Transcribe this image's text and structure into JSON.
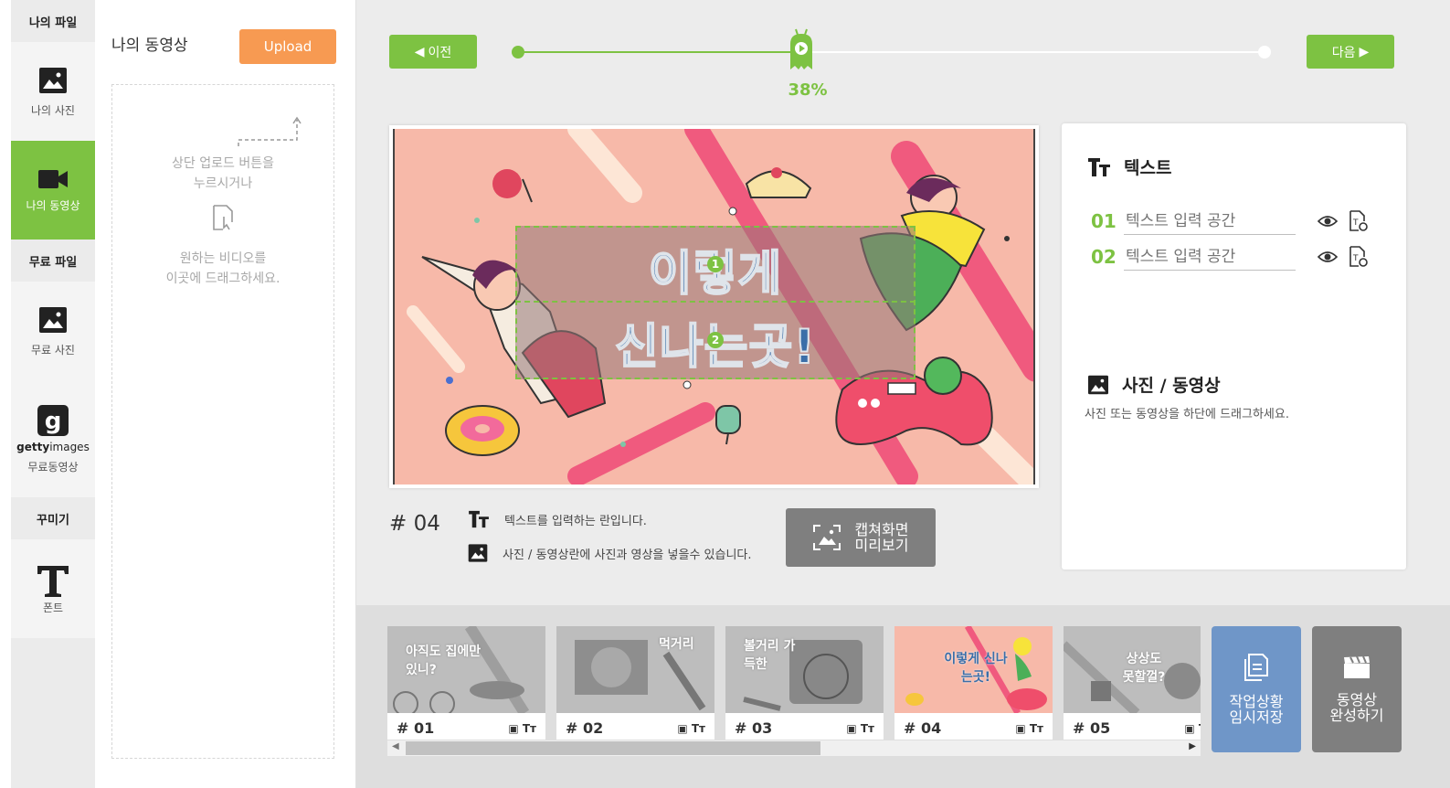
{
  "sidebar": {
    "my_files_header": "나의 파일",
    "my_photo": "나의 사진",
    "my_video": "나의 동영상",
    "free_files_header": "무료 파일",
    "free_photo": "무료 사진",
    "getty_brand_bold": "getty",
    "getty_brand": "images",
    "free_video": "무료동영상",
    "decorate_header": "꾸미기",
    "font": "폰트"
  },
  "files_panel": {
    "title": "나의 동영상",
    "upload_label": "Upload",
    "hint_line1": "상단 업로드 버튼을",
    "hint_line2": "누르시거나",
    "hint_line3": "원하는 비디오를",
    "hint_line4": "이곳에 드래그하세요."
  },
  "progress": {
    "prev_label": "이전",
    "next_label": "다음",
    "percent_text": "38%",
    "fraction": 0.38
  },
  "canvas": {
    "line1": "이렇게",
    "line2": "신나는곳!",
    "marker1": "1",
    "marker2": "2"
  },
  "scene": {
    "number": "# 04",
    "text_hint": "텍스트를 입력하는 란입니다.",
    "media_hint": "사진 / 동영상란에 사진과 영상을 넣을수 있습니다.",
    "capture_line1": "캡쳐화면",
    "capture_line2": "미리보기"
  },
  "props": {
    "text_title": "텍스트",
    "text_rows": [
      {
        "num": "01",
        "placeholder": "텍스트 입력 공간"
      },
      {
        "num": "02",
        "placeholder": "텍스트 입력 공간"
      }
    ],
    "media_title": "사진 / 동영상",
    "media_hint": "사진 또는 동영상을 하단에 드래그하세요."
  },
  "thumbnails": [
    {
      "label": "# 01",
      "text": "아직도 집에만 있니?"
    },
    {
      "label": "# 02",
      "text": "먹거리"
    },
    {
      "label": "# 03",
      "text": "볼거리 가득한"
    },
    {
      "label": "# 04",
      "text": "이렇게 신나는곳!"
    },
    {
      "label": "# 05",
      "text": "상상도 못할껄?"
    }
  ],
  "actions": {
    "save_line1": "작업상황",
    "save_line2": "임시저장",
    "finish_line1": "동영상",
    "finish_line2": "완성하기"
  },
  "colors": {
    "accent_green": "#7dc242",
    "upload_orange": "#f79a52",
    "save_blue": "#6f96c8",
    "finish_gray": "#7f7f7f",
    "canvas_pink": "#f7b9a9"
  }
}
